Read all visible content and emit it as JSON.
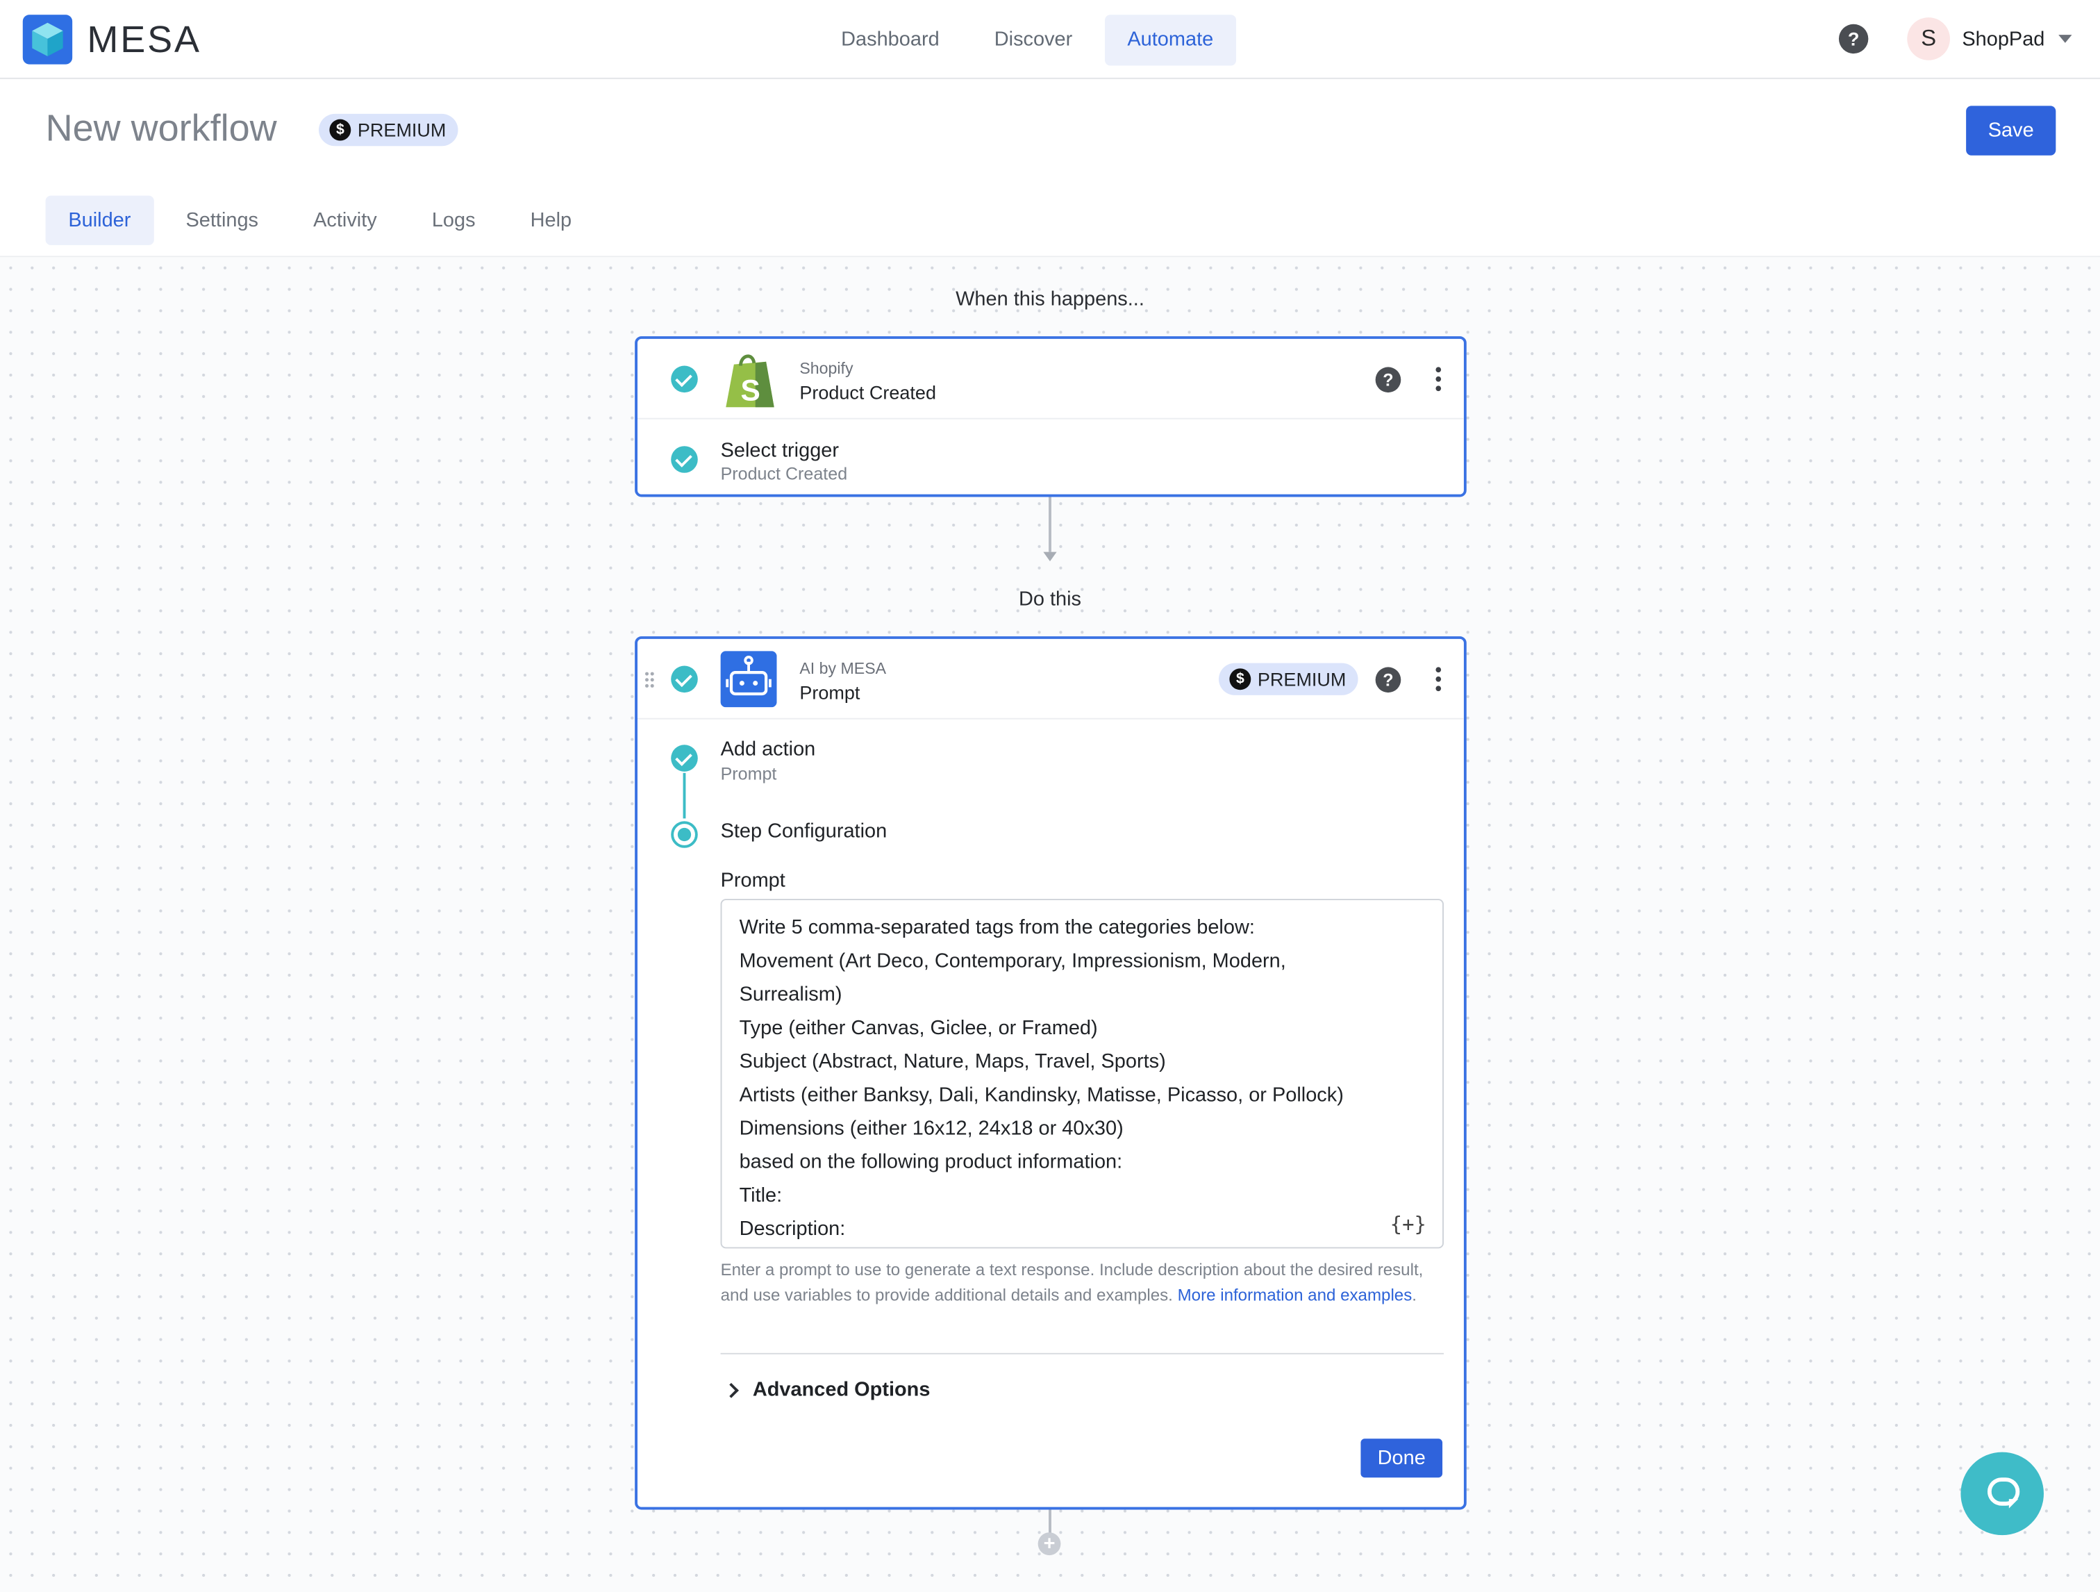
{
  "brand": {
    "name": "MESA",
    "logo_icon": "cube-logo-icon",
    "accent_color": "#2f63dc"
  },
  "nav": {
    "tabs": [
      {
        "label": "Dashboard",
        "active": false
      },
      {
        "label": "Discover",
        "active": false
      },
      {
        "label": "Automate",
        "active": true
      }
    ],
    "help_icon": "question-circle-icon",
    "user": {
      "initial": "S",
      "name": "ShopPad"
    }
  },
  "header": {
    "title": "New workflow",
    "badge": {
      "symbol": "$",
      "label": "PREMIUM"
    },
    "save_label": "Save",
    "tabs": [
      {
        "label": "Builder",
        "active": true
      },
      {
        "label": "Settings",
        "active": false
      },
      {
        "label": "Activity",
        "active": false
      },
      {
        "label": "Logs",
        "active": false
      },
      {
        "label": "Help",
        "active": false
      }
    ]
  },
  "canvas": {
    "trigger_heading": "When this happens...",
    "action_heading": "Do this"
  },
  "trigger_card": {
    "app": "Shopify",
    "event": "Product Created",
    "icon": "shopify-bag-icon",
    "step": {
      "title": "Select trigger",
      "subtitle": "Product Created"
    }
  },
  "action_card": {
    "app": "AI by MESA",
    "event": "Prompt",
    "icon": "robot-icon",
    "badge": {
      "symbol": "$",
      "label": "PREMIUM"
    },
    "steps": [
      {
        "title": "Add action",
        "subtitle": "Prompt"
      },
      {
        "title": "Step Configuration"
      }
    ],
    "field_label": "Prompt",
    "prompt_lines": [
      "Write 5 comma-separated tags from the categories below:",
      "Movement (Art Deco, Contemporary, Impressionism, Modern,",
      "Surrealism)",
      "Type (either Canvas, Giclee, or Framed)",
      "Subject (Abstract, Nature, Maps, Travel, Sports)",
      "Artists (either Banksy, Dali, Kandinsky, Matisse, Picasso, or Pollock)",
      "Dimensions (either 16x12, 24x18 or 40x30)",
      "based on the following product information:",
      "Title:",
      "Description:"
    ],
    "variable_button": "{+}",
    "help_text": "Enter a prompt to use to generate a text response. Include description about the desired result, and use variables to provide additional details and examples.",
    "help_link": "More information and examples",
    "help_end": ".",
    "advanced_label": "Advanced Options",
    "done_label": "Done"
  },
  "add_step_icon": "plus-circle-icon",
  "chat_icon": "chat-bubble-icon"
}
